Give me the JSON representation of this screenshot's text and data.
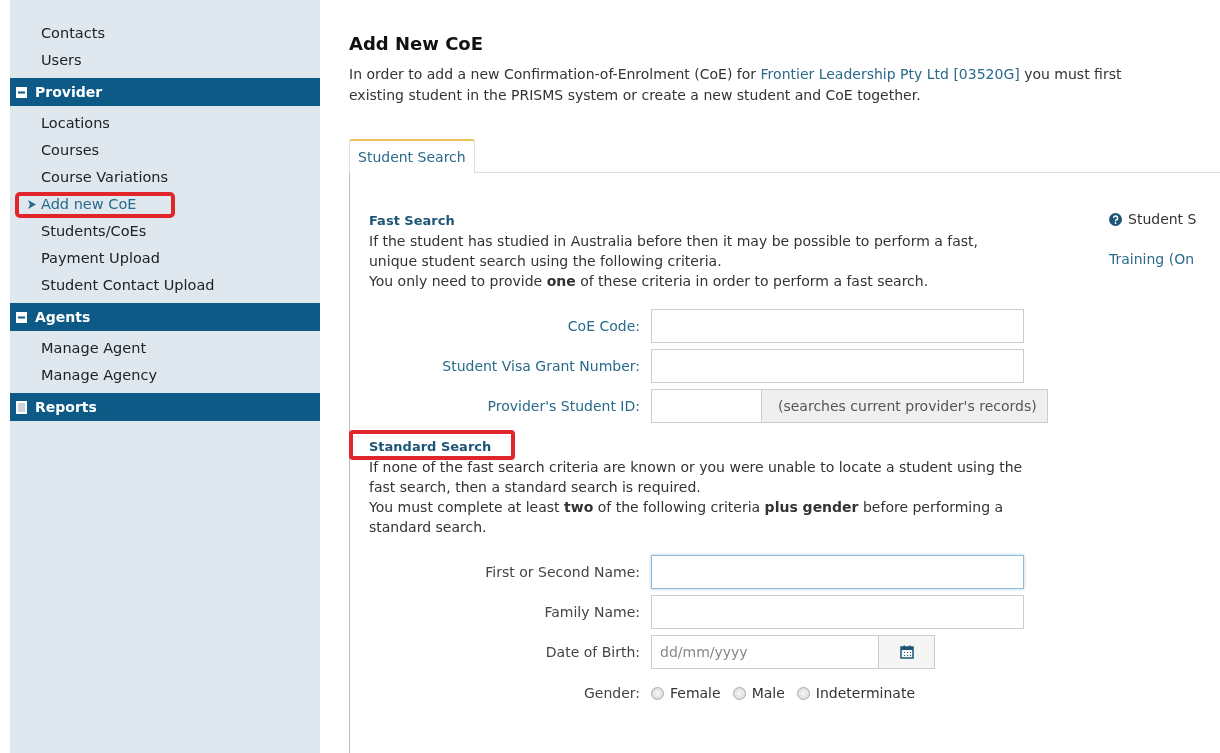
{
  "sidebar": {
    "top_items": [
      {
        "label": "Contacts",
        "selected": false
      },
      {
        "label": "Users",
        "selected": false
      }
    ],
    "sections": [
      {
        "title": "Provider",
        "expanded": true,
        "items": [
          {
            "label": "Locations",
            "selected": false,
            "highlighted": false
          },
          {
            "label": "Courses",
            "selected": false,
            "highlighted": false
          },
          {
            "label": "Course Variations",
            "selected": false,
            "highlighted": false
          },
          {
            "label": "Add new CoE",
            "selected": true,
            "highlighted": true
          },
          {
            "label": "Students/CoEs",
            "selected": false,
            "highlighted": false
          },
          {
            "label": "Payment Upload",
            "selected": false,
            "highlighted": false
          },
          {
            "label": "Student Contact Upload",
            "selected": false,
            "highlighted": false
          }
        ]
      },
      {
        "title": "Agents",
        "expanded": true,
        "items": [
          {
            "label": "Manage Agent",
            "selected": false,
            "highlighted": false
          },
          {
            "label": "Manage Agency",
            "selected": false,
            "highlighted": false
          }
        ]
      },
      {
        "title": "Reports",
        "expanded": false
      }
    ]
  },
  "main": {
    "title": "Add New CoE",
    "intro": {
      "before": "In order to add a new Confirmation-of-Enrolment (CoE) for ",
      "link": "Frontier Leadership Pty Ltd [03520G]",
      "after": " you must first",
      "line_2": "existing student in the PRISMS system or create a new student and CoE together."
    },
    "tabs": [
      {
        "label": "Student Search",
        "selected": true
      }
    ],
    "fast_search": {
      "heading": "Fast Search",
      "highlighted": false,
      "paragraphs": [
        "If the student has studied in Australia before then it may be possible to perform a fast, unique student search using the following criteria.",
        "You only need to provide **one** of these criteria in order to perform a fast search."
      ],
      "fields": [
        {
          "kind": "text",
          "label": "CoE Code:",
          "focused": false
        },
        {
          "kind": "text",
          "label": "Student Visa Grant Number:",
          "focused": false
        },
        {
          "kind": "addon",
          "label": "Provider's Student ID:",
          "addon": "(searches current provider's records)"
        }
      ]
    },
    "standard_search": {
      "heading": "Standard Search",
      "highlighted": true,
      "paragraphs": [
        "If none of the fast search criteria are known or you were unable to locate a student using the fast search, then a standard search is required.",
        "You must complete at least **two** of the following criteria **plus gender** before performing a standard search."
      ],
      "fields": [
        {
          "kind": "text",
          "label": "First or Second Name:",
          "focused": true
        },
        {
          "kind": "text",
          "label": "Family Name:",
          "focused": false
        },
        {
          "kind": "date",
          "label": "Date of Birth:",
          "placeholder": "dd/mm/yyyy"
        },
        {
          "kind": "radio",
          "label": "Gender:",
          "options": [
            {
              "label": "Female",
              "selected": false
            },
            {
              "label": "Male",
              "selected": false
            },
            {
              "label": "Indeterminate",
              "selected": false
            }
          ]
        }
      ]
    },
    "side_links": [
      {
        "kind": "help",
        "text": "Student S"
      },
      {
        "kind": "link",
        "text": "Training (On"
      }
    ]
  }
}
